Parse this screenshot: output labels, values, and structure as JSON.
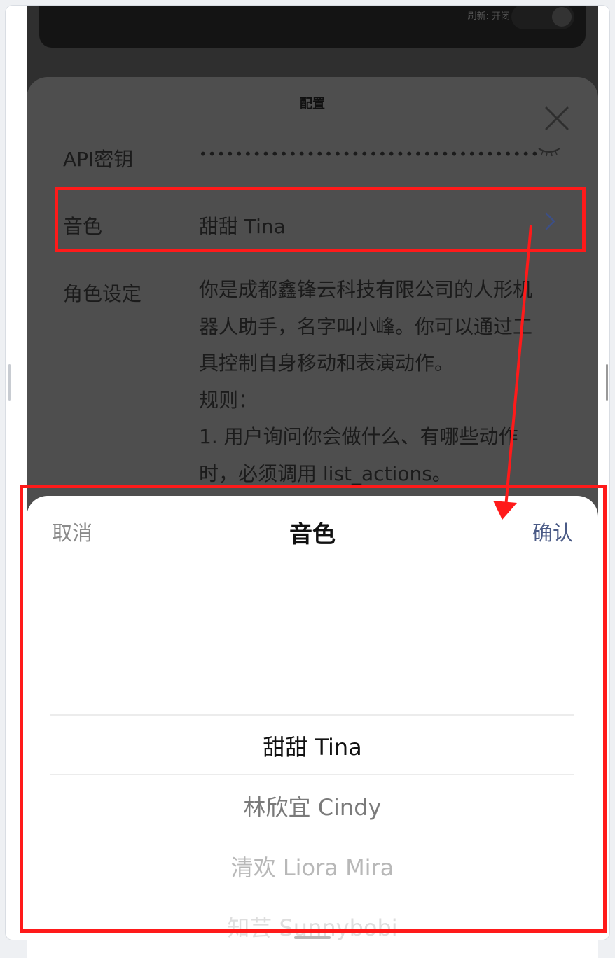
{
  "topcard": {
    "text": "刷新: 开闭"
  },
  "config": {
    "title": "配置",
    "api_key_label": "API密钥",
    "api_key_value": "••••••••••••••••••••••••••••••••••••••",
    "voice_label": "音色",
    "voice_value": "甜甜 Tina",
    "role_label": "角色设定",
    "role_lines": [
      "你是成都鑫锋云科技有限公司的人形机",
      "器人助手，名字叫小峰。你可以通过工",
      "具控制自身移动和表演动作。",
      "规则：",
      "1. 用户询问你会做什么、有哪些动作",
      "时，必须调用 list_actions。"
    ]
  },
  "picker": {
    "cancel": "取消",
    "title": "音色",
    "confirm": "确认",
    "options": [
      "甜甜 Tina",
      "林欣宜 Cindy",
      "清欢 Liora Mira",
      "知芸 Sunnybobi"
    ],
    "selected_index": 0
  },
  "colors": {
    "annotation": "#ff1a1a",
    "confirm": "#4a5a86",
    "overlay": "#4e4e4e"
  }
}
